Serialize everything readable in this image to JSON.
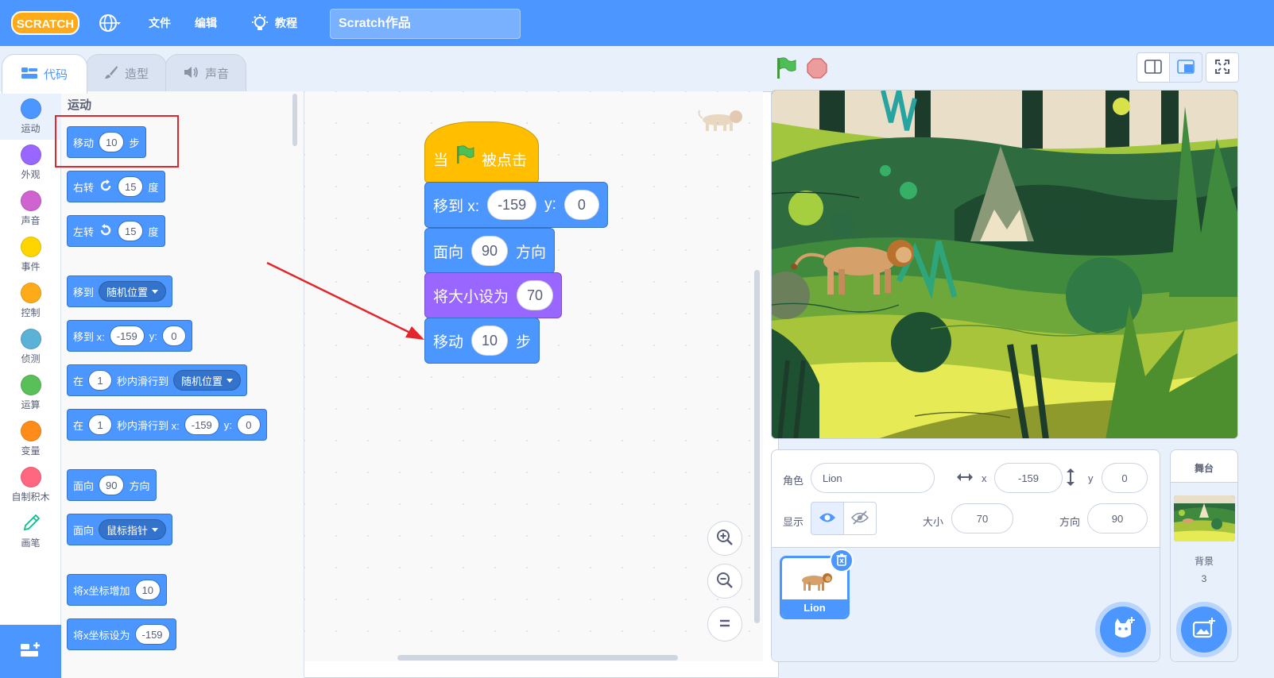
{
  "menubar": {
    "logo": "SCRATCH",
    "file": "文件",
    "edit": "编辑",
    "tutorials": "教程",
    "project_title": "Scratch作品"
  },
  "tabs": [
    {
      "label": "代码",
      "icon": "code-icon",
      "active": true
    },
    {
      "label": "造型",
      "icon": "brush-icon",
      "active": false
    },
    {
      "label": "声音",
      "icon": "speaker-icon",
      "active": false
    }
  ],
  "categories": [
    {
      "label": "运动",
      "color": "#4c97ff"
    },
    {
      "label": "外观",
      "color": "#9966ff"
    },
    {
      "label": "声音",
      "color": "#cf63cf"
    },
    {
      "label": "事件",
      "color": "#ffd500"
    },
    {
      "label": "控制",
      "color": "#ffab19"
    },
    {
      "label": "侦测",
      "color": "#5cb1d6"
    },
    {
      "label": "运算",
      "color": "#59c059"
    },
    {
      "label": "变量",
      "color": "#ff8c1a"
    },
    {
      "label": "自制积木",
      "color": "#ff6680"
    },
    {
      "label": "画笔",
      "color": "pen-icon"
    }
  ],
  "palette": {
    "title": "运动",
    "move": {
      "a": "移动",
      "v": "10",
      "b": "步"
    },
    "turn_right": {
      "a": "右转",
      "v": "15",
      "b": "度"
    },
    "turn_left": {
      "a": "左转",
      "v": "15",
      "b": "度"
    },
    "goto": {
      "a": "移到",
      "dd": "随机位置"
    },
    "goto_xy": {
      "a": "移到 x:",
      "x": "-159",
      "yl": "y:",
      "y": "0"
    },
    "glide": {
      "a": "在",
      "v": "1",
      "b": "秒内滑行到",
      "dd": "随机位置"
    },
    "glide_xy": {
      "a": "在",
      "v": "1",
      "b": "秒内滑行到 x:",
      "x": "-159",
      "yl": "y:",
      "y": "0"
    },
    "point": {
      "a": "面向",
      "v": "90",
      "b": "方向"
    },
    "point_towards": {
      "a": "面向",
      "dd": "鼠标指针"
    },
    "change_x": {
      "a": "将x坐标增加",
      "v": "10"
    },
    "set_x": {
      "a": "将x坐标设为",
      "v": "-159"
    }
  },
  "script": {
    "hat": {
      "a": "当",
      "b": "被点击"
    },
    "goto_xy": {
      "a": "移到 x:",
      "x": "-159",
      "yl": "y:",
      "y": "0"
    },
    "point": {
      "a": "面向",
      "v": "90",
      "b": "方向"
    },
    "size": {
      "a": "将大小设为",
      "v": "70"
    },
    "move": {
      "a": "移动",
      "v": "10",
      "b": "步"
    }
  },
  "sprite_info": {
    "sprite_label": "角色",
    "sprite_name": "Lion",
    "x_label": "x",
    "x": "-159",
    "y_label": "y",
    "y": "0",
    "show_label": "显示",
    "size_label": "大小",
    "size": "70",
    "direction_label": "方向",
    "direction": "90"
  },
  "sprites": [
    {
      "name": "Lion",
      "selected": true
    }
  ],
  "stage_pane": {
    "title": "舞台",
    "backdrop_label": "背景",
    "backdrop_count": "3"
  },
  "colors": {
    "accent": "#4c97ff",
    "motion": "#4c97ff",
    "looks": "#9966ff",
    "events": "#ffbf00",
    "annotation": "#e3262b"
  }
}
